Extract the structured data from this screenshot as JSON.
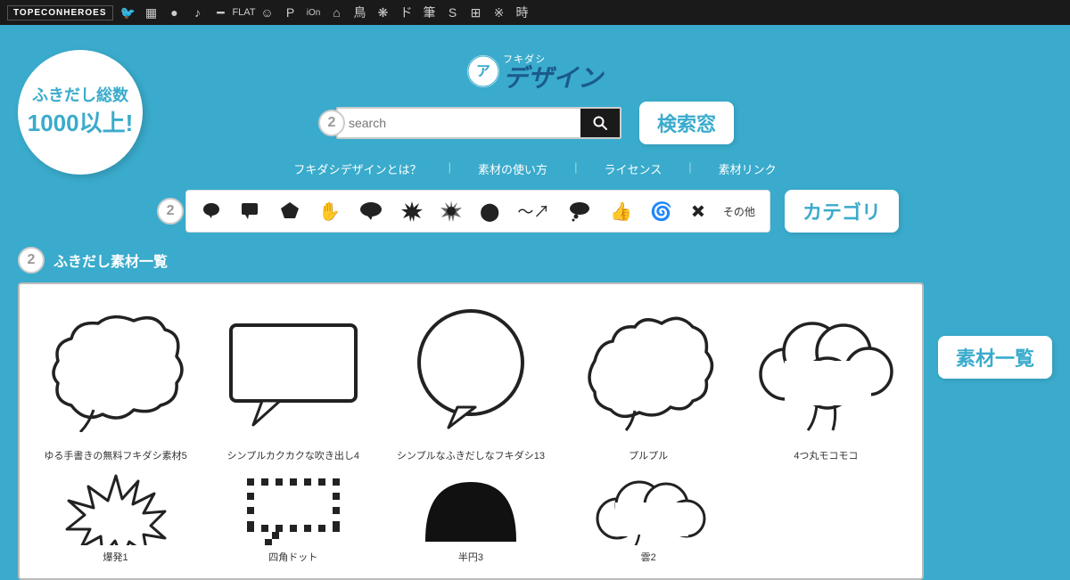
{
  "topbar": {
    "brand": "TOPECONHEROES",
    "icons": [
      "🐦",
      "🔲",
      "●",
      "♪",
      "━",
      "FL",
      "⊙",
      "P",
      "iOn",
      "⌂",
      "鳥",
      "❋",
      "ド",
      "筆",
      "S",
      "⊞",
      "※",
      "時"
    ]
  },
  "header": {
    "logo_symbol": "ア",
    "logo_furigana": "フキダシ",
    "logo_design": "デザイン",
    "tagline_top": "ふきだし総数",
    "tagline_num": "1000以上!",
    "search_placeholder": "search",
    "search_label": "検索窓"
  },
  "nav": {
    "links": [
      "フキダシデザインとは？",
      "素材の使い方",
      "ライセンス",
      "素材リンク"
    ]
  },
  "category": {
    "label": "カテゴリ",
    "step": "2",
    "items": [
      {
        "name": "speech-bubble-round",
        "icon": "●"
      },
      {
        "name": "speech-bubble-rect",
        "icon": "▬"
      },
      {
        "name": "pentagon",
        "icon": "⬟"
      },
      {
        "name": "hand",
        "icon": "✋"
      },
      {
        "name": "speech-oval",
        "icon": "💬"
      },
      {
        "name": "burst",
        "icon": "✳"
      },
      {
        "name": "sun-burst",
        "icon": "✴"
      },
      {
        "name": "circle",
        "icon": "⬤"
      },
      {
        "name": "wave",
        "icon": "〜"
      },
      {
        "name": "cloud-bubble",
        "icon": "💭"
      },
      {
        "name": "thumbs-up",
        "icon": "👍"
      },
      {
        "name": "spiral",
        "icon": "🌀"
      },
      {
        "name": "star-cross",
        "icon": "✳"
      },
      {
        "name": "other",
        "icon": "その他"
      }
    ]
  },
  "materials": {
    "title": "ふきだし素材一覧",
    "label": "素材一覧",
    "step": "2",
    "items": [
      {
        "name": "ゆる手書きの無料フキダシ素材5",
        "type": "cloud-bubble"
      },
      {
        "name": "シンプルカクカクな吹き出し4",
        "type": "rect-bubble"
      },
      {
        "name": "シンプルなふきだしなフキダシ13",
        "type": "circle-bubble"
      },
      {
        "name": "プルプル",
        "type": "wavy-bubble"
      },
      {
        "name": "4つ丸モコモコ",
        "type": "cloud-bubble2"
      }
    ],
    "items2": [
      {
        "name": "爆発1",
        "type": "explosion"
      },
      {
        "name": "四角ドット",
        "type": "dotted-rect"
      },
      {
        "name": "半円3",
        "type": "half-circle"
      },
      {
        "name": "雲2",
        "type": "cloud2"
      },
      {
        "name": "",
        "type": "empty"
      }
    ]
  }
}
